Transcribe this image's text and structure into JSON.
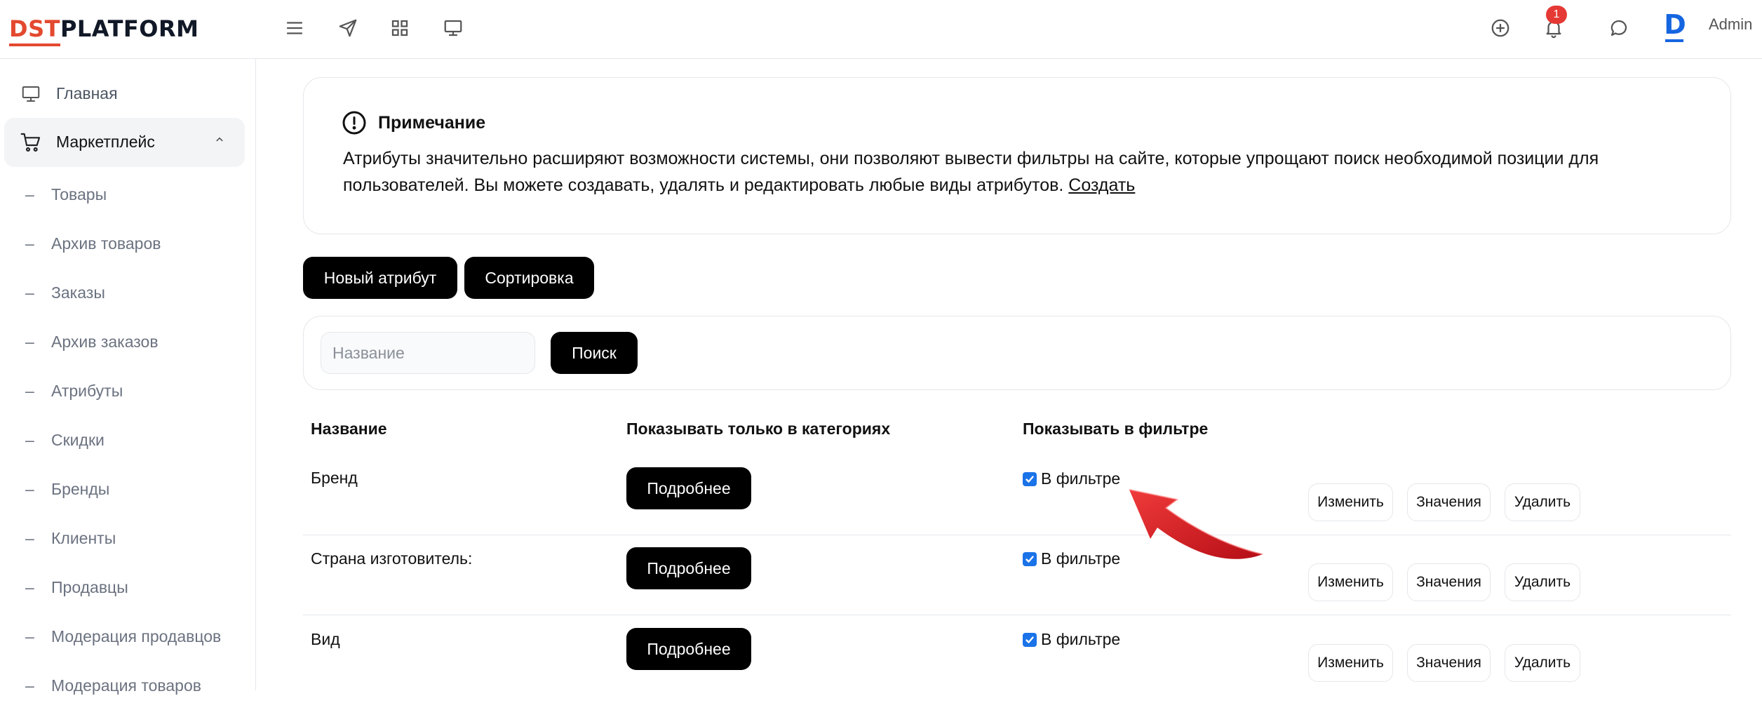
{
  "header": {
    "logo_dst": "DST",
    "logo_platform": "PLATFORM",
    "notifications_count": "1",
    "user_initial": "D",
    "user_name": "Admin"
  },
  "sidebar": {
    "home": "Главная",
    "marketplace": "Маркетплейс",
    "sub_items": [
      "Товары",
      "Архив товаров",
      "Заказы",
      "Архив заказов",
      "Атрибуты",
      "Скидки",
      "Бренды",
      "Клиенты",
      "Продавцы",
      "Модерация продавцов",
      "Модерация товаров"
    ],
    "dash": "–"
  },
  "note": {
    "title": "Примечание",
    "text": "Атрибуты значительно расширяют возможности системы, они позволяют вывести фильтры на сайте, которые упрощают поиск необходимой позиции для пользователей. Вы можете создавать, удалять и редактировать любые виды атрибутов.",
    "link": "Создать"
  },
  "toolbar": {
    "new_attribute": "Новый атрибут",
    "sort": "Сортировка"
  },
  "search": {
    "placeholder": "Название",
    "button": "Поиск"
  },
  "table": {
    "headers": {
      "name": "Название",
      "categories": "Показывать только в категориях",
      "filter": "Показывать в фильтре"
    },
    "rows": [
      {
        "name": "Бренд",
        "details": "Подробнее",
        "filter_label": "В фильтре",
        "checked": true
      },
      {
        "name": "Страна изготовитель:",
        "details": "Подробнее",
        "filter_label": "В фильтре",
        "checked": true
      },
      {
        "name": "Вид",
        "details": "Подробнее",
        "filter_label": "В фильтре",
        "checked": true
      }
    ],
    "actions": {
      "edit": "Изменить",
      "values": "Значения",
      "delete": "Удалить"
    }
  },
  "colors": {
    "brand_red": "#e3492f",
    "accent_blue": "#1565e0",
    "badge_red": "#e53935",
    "checkbox_blue": "#1a73e8",
    "arrow_red": "#d9141e"
  }
}
